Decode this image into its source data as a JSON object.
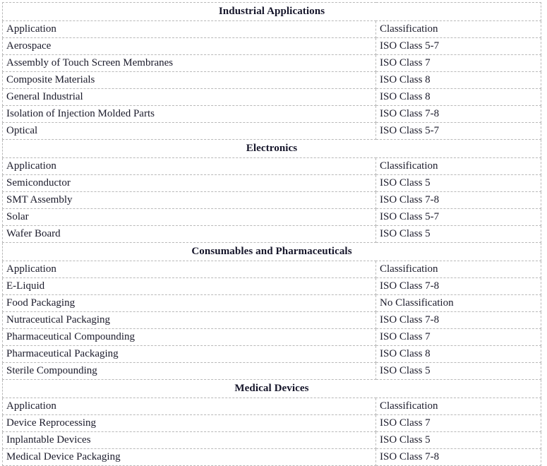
{
  "document": {
    "type": "classification-table",
    "column_headers": [
      "Application",
      "Classification"
    ],
    "border_color": "#b9b9b9",
    "text_color": "#1b1b2b",
    "sections": [
      {
        "title": "Industrial Applications",
        "headers": [
          "Application",
          "Classification"
        ],
        "rows": [
          [
            "Aerospace",
            "ISO Class 5-7"
          ],
          [
            "Assembly of Touch Screen Membranes",
            "ISO Class 7"
          ],
          [
            "Composite Materials",
            "ISO Class 8"
          ],
          [
            "General Industrial",
            "ISO Class 8"
          ],
          [
            "Isolation of Injection Molded Parts",
            "ISO Class 7-8"
          ],
          [
            "Optical",
            "ISO Class 5-7"
          ]
        ]
      },
      {
        "title": "Electronics",
        "headers": [
          "Application",
          "Classification"
        ],
        "rows": [
          [
            "Semiconductor",
            "ISO Class 5"
          ],
          [
            "SMT Assembly",
            "ISO Class 7-8"
          ],
          [
            "Solar",
            "ISO Class 5-7"
          ],
          [
            "Wafer Board",
            "ISO Class 5"
          ]
        ]
      },
      {
        "title": "Consumables and Pharmaceuticals",
        "headers": [
          "Application",
          "Classification"
        ],
        "rows": [
          [
            "E-Liquid",
            "ISO Class 7-8"
          ],
          [
            "Food Packaging",
            "No Classification"
          ],
          [
            "Nutraceutical Packaging",
            "ISO Class 7-8"
          ],
          [
            "Pharmaceutical Compounding",
            "ISO Class 7"
          ],
          [
            "Pharmaceutical Packaging",
            "ISO Class 8"
          ],
          [
            "Sterile Compounding",
            "ISO Class 5"
          ]
        ]
      },
      {
        "title": "Medical Devices",
        "headers": [
          "Application",
          "Classification"
        ],
        "rows": [
          [
            "Device Reprocessing",
            "ISO Class 7"
          ],
          [
            "Inplantable Devices",
            "ISO Class 5"
          ],
          [
            "Medical Device Packaging",
            "ISO Class 7-8"
          ]
        ]
      }
    ]
  }
}
